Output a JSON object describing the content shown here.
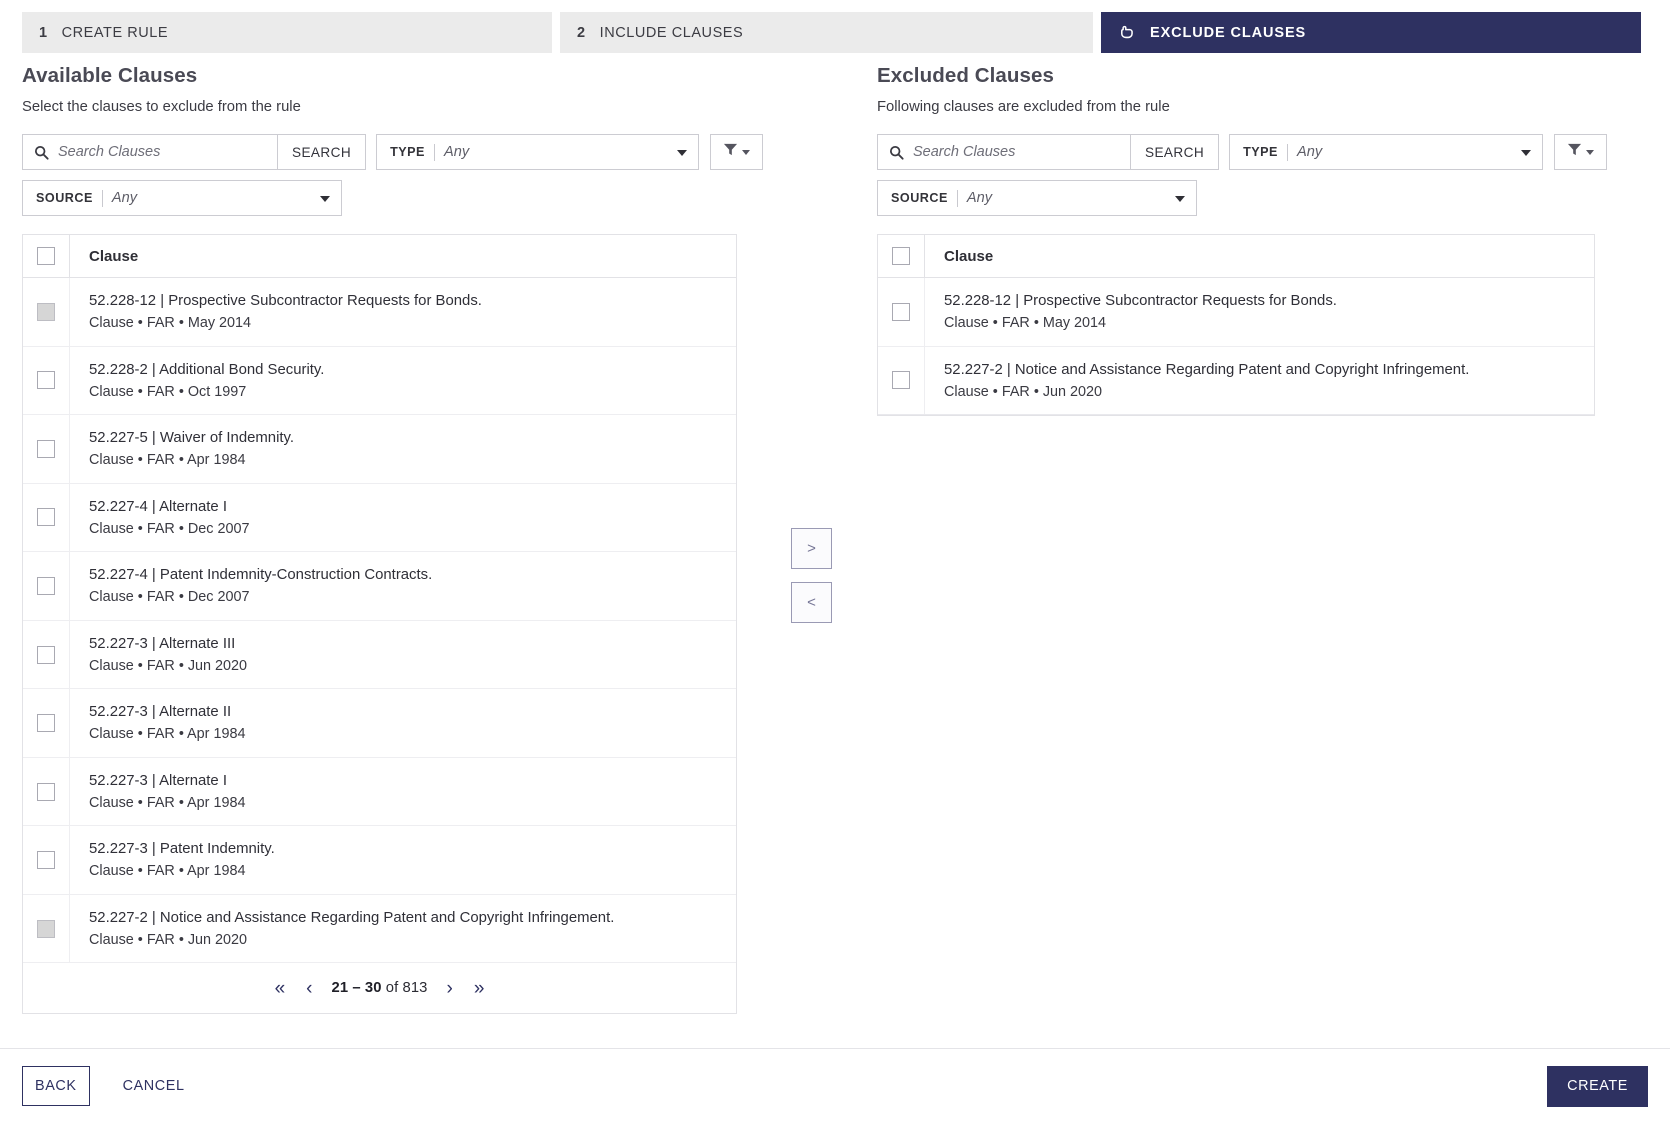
{
  "stepper": {
    "steps": [
      {
        "num": "1",
        "label": "CREATE RULE",
        "active": false
      },
      {
        "num": "2",
        "label": "INCLUDE CLAUSES",
        "active": false
      },
      {
        "num": "",
        "label": "EXCLUDE CLAUSES",
        "active": true,
        "icon": "hand-pointer-icon"
      }
    ]
  },
  "available": {
    "title": "Available Clauses",
    "subtitle": "Select the clauses to exclude from the rule",
    "search": {
      "placeholder": "Search Clauses",
      "value": "",
      "button": "SEARCH"
    },
    "type_filter": {
      "label": "TYPE",
      "value": "Any"
    },
    "source_filter": {
      "label": "SOURCE",
      "value": "Any"
    },
    "column_header": "Clause",
    "rows": [
      {
        "title": "52.228-12 | Prospective Subcontractor Requests for Bonds.",
        "meta": "Clause • FAR • May 2014",
        "checkbox": "disabled"
      },
      {
        "title": "52.228-2 | Additional Bond Security.",
        "meta": "Clause • FAR • Oct 1997",
        "checkbox": "empty"
      },
      {
        "title": "52.227-5 | Waiver of Indemnity.",
        "meta": "Clause • FAR • Apr 1984",
        "checkbox": "empty"
      },
      {
        "title": "52.227-4 | Alternate I",
        "meta": "Clause • FAR • Dec 2007",
        "checkbox": "empty"
      },
      {
        "title": "52.227-4 | Patent Indemnity-Construction Contracts.",
        "meta": "Clause • FAR • Dec 2007",
        "checkbox": "empty"
      },
      {
        "title": "52.227-3 | Alternate III",
        "meta": "Clause • FAR • Jun 2020",
        "checkbox": "empty"
      },
      {
        "title": "52.227-3 | Alternate II",
        "meta": "Clause • FAR • Apr 1984",
        "checkbox": "empty"
      },
      {
        "title": "52.227-3 | Alternate I",
        "meta": "Clause • FAR • Apr 1984",
        "checkbox": "empty"
      },
      {
        "title": "52.227-3 | Patent Indemnity.",
        "meta": "Clause • FAR • Apr 1984",
        "checkbox": "empty"
      },
      {
        "title": "52.227-2 | Notice and Assistance Regarding Patent and Copyright Infringement.",
        "meta": "Clause • FAR • Jun 2020",
        "checkbox": "disabled"
      }
    ],
    "pagination": {
      "first": "«",
      "prev": "‹",
      "range": "21 – 30",
      "suffix": " of 813",
      "next": "›",
      "last": "»"
    }
  },
  "excluded": {
    "title": "Excluded Clauses",
    "subtitle": "Following clauses are excluded from the rule",
    "search": {
      "placeholder": "Search Clauses",
      "value": "",
      "button": "SEARCH"
    },
    "type_filter": {
      "label": "TYPE",
      "value": "Any"
    },
    "source_filter": {
      "label": "SOURCE",
      "value": "Any"
    },
    "column_header": "Clause",
    "rows": [
      {
        "title": "52.228-12 | Prospective Subcontractor Requests for Bonds.",
        "meta": "Clause • FAR • May 2014",
        "checkbox": "empty"
      },
      {
        "title": "52.227-2 | Notice and Assistance Regarding Patent and Copyright Infringement.",
        "meta": "Clause • FAR • Jun 2020",
        "checkbox": "empty"
      }
    ]
  },
  "transfer": {
    "to_excluded": ">",
    "to_available": "<"
  },
  "footer": {
    "back": "BACK",
    "cancel": "CANCEL",
    "create": "CREATE"
  },
  "colors": {
    "navy": "#2e3161",
    "tab_inactive_bg": "#ebebeb",
    "border": "#ccccd2"
  }
}
